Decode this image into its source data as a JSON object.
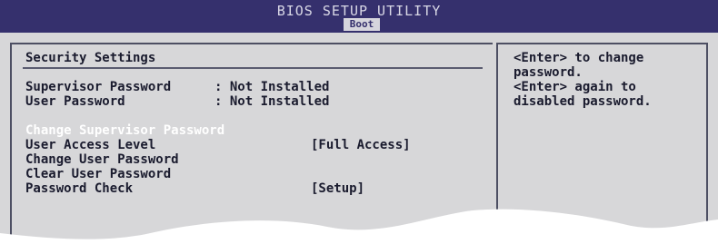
{
  "header": {
    "title": "BIOS SETUP UTILITY",
    "active_tab": "Boot"
  },
  "section": {
    "title": "Security Settings"
  },
  "status": {
    "supervisor_label": "Supervisor Password",
    "supervisor_value": ": Not Installed",
    "user_label": "User Password",
    "user_value": ": Not Installed"
  },
  "menu": {
    "change_supervisor": "Change Supervisor Password",
    "user_access_label": "User Access Level",
    "user_access_value": "[Full Access]",
    "change_user": "Change User Password",
    "clear_user": "Clear User Password",
    "password_check_label": "Password Check",
    "password_check_value": "[Setup]"
  },
  "help": {
    "line1": "<Enter> to change",
    "line2": "password.",
    "line3": "<Enter> again to",
    "line4": "disabled password."
  },
  "colors": {
    "header_bg": "#35306d",
    "panel_bg": "#d7d7d9",
    "text": "#1a1b2e",
    "highlight_text": "#ffffff"
  }
}
